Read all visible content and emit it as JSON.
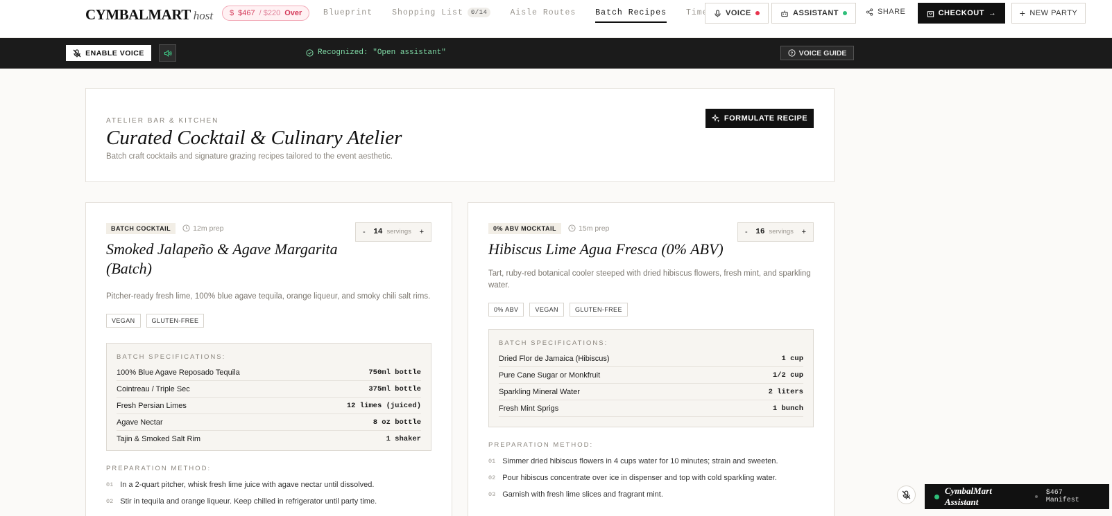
{
  "header": {
    "brand": "CYMBALMART",
    "brand_sub": "host",
    "budget": {
      "spent": "$467",
      "limit": "/ $220",
      "status": "Over"
    },
    "tabs": [
      {
        "label": "Blueprint"
      },
      {
        "label": "Shopping List",
        "count": "0/14"
      },
      {
        "label": "Aisle Routes"
      },
      {
        "label": "Batch Recipes",
        "active": true
      },
      {
        "label": "Timeline"
      }
    ],
    "voice_label": "VOICE",
    "assistant_label": "ASSISTANT",
    "share_label": "SHARE",
    "checkout_label": "CHECKOUT",
    "new_party_label": "NEW PARTY",
    "colors": {
      "voice_dot": "#e8344e",
      "assistant_dot": "#2fbf7a"
    }
  },
  "voicebar": {
    "enable_label": "ENABLE VOICE",
    "recognized": "Recognized: \"Open assistant\"",
    "guide_label": "VOICE GUIDE"
  },
  "hero": {
    "eyebrow": "ATELIER BAR & KITCHEN",
    "title": "Curated Cocktail & Culinary Atelier",
    "subtitle": "Batch craft cocktails and signature grazing recipes tailored to the event aesthetic.",
    "action_label": "FORMULATE RECIPE"
  },
  "recipes": [
    {
      "badge": "BATCH COCKTAIL",
      "prep": "12m prep",
      "servings": "14",
      "servings_unit": "servings",
      "title": "Smoked Jalapeño & Agave Margarita (Batch)",
      "description": "Pitcher-ready fresh lime, 100% blue agave tequila, orange liqueur, and smoky chili salt rims.",
      "tags": [
        "VEGAN",
        "GLUTEN-FREE"
      ],
      "specs_title": "BATCH SPECIFICATIONS:",
      "specs": [
        {
          "name": "100% Blue Agave Reposado Tequila",
          "qty": "750ml bottle"
        },
        {
          "name": "Cointreau / Triple Sec",
          "qty": "375ml bottle"
        },
        {
          "name": "Fresh Persian Limes",
          "qty": "12 limes (juiced)"
        },
        {
          "name": "Agave Nectar",
          "qty": "8 oz bottle"
        },
        {
          "name": "Tajin & Smoked Salt Rim",
          "qty": "1 shaker"
        }
      ],
      "method_title": "PREPARATION METHOD:",
      "steps": [
        {
          "num": "01",
          "text": "In a 2-quart pitcher, whisk fresh lime juice with agave nectar until dissolved."
        },
        {
          "num": "02",
          "text": "Stir in tequila and orange liqueur. Keep chilled in refrigerator until party time."
        }
      ]
    },
    {
      "badge": "0% ABV MOCKTAIL",
      "prep": "15m prep",
      "servings": "16",
      "servings_unit": "servings",
      "title": "Hibiscus Lime Agua Fresca (0% ABV)",
      "description": "Tart, ruby-red botanical cooler steeped with dried hibiscus flowers, fresh mint, and sparkling water.",
      "tags": [
        "0% ABV",
        "VEGAN",
        "GLUTEN-FREE"
      ],
      "specs_title": "BATCH SPECIFICATIONS:",
      "specs": [
        {
          "name": "Dried Flor de Jamaica (Hibiscus)",
          "qty": "1 cup"
        },
        {
          "name": "Pure Cane Sugar or Monkfruit",
          "qty": "1/2 cup"
        },
        {
          "name": "Sparkling Mineral Water",
          "qty": "2 liters"
        },
        {
          "name": "Fresh Mint Sprigs",
          "qty": "1 bunch"
        }
      ],
      "method_title": "PREPARATION METHOD:",
      "steps": [
        {
          "num": "01",
          "text": "Simmer dried hibiscus flowers in 4 cups water for 10 minutes; strain and sweeten."
        },
        {
          "num": "02",
          "text": "Pour hibiscus concentrate over ice in dispenser and top with cold sparkling water."
        },
        {
          "num": "03",
          "text": "Garnish with fresh lime slices and fragrant mint."
        }
      ]
    }
  ],
  "dock": {
    "assistant_name": "CymbalMart Assistant",
    "manifest": "$467 Manifest"
  }
}
